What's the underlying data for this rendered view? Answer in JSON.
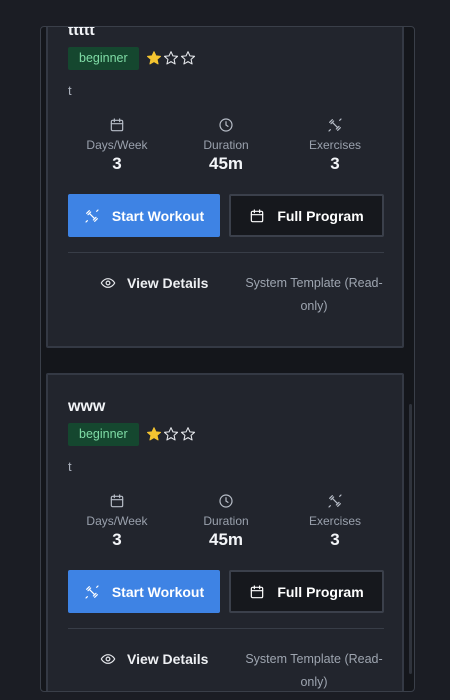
{
  "cards": [
    {
      "title": "ttttt",
      "badge": "beginner",
      "rating": {
        "filled": 1,
        "total": 3
      },
      "description": "t",
      "stats": [
        {
          "icon": "calendar-icon",
          "label": "Days/Week",
          "value": "3"
        },
        {
          "icon": "clock-icon",
          "label": "Duration",
          "value": "45m"
        },
        {
          "icon": "dumbbell-icon",
          "label": "Exercises",
          "value": "3"
        }
      ],
      "start_label": "Start Workout",
      "program_label": "Full Program",
      "details_label": "View Details",
      "note": "System Template (Read-only)"
    },
    {
      "title": "www",
      "badge": "beginner",
      "rating": {
        "filled": 1,
        "total": 3
      },
      "description": "t",
      "stats": [
        {
          "icon": "calendar-icon",
          "label": "Days/Week",
          "value": "3"
        },
        {
          "icon": "clock-icon",
          "label": "Duration",
          "value": "45m"
        },
        {
          "icon": "dumbbell-icon",
          "label": "Exercises",
          "value": "3"
        }
      ],
      "start_label": "Start Workout",
      "program_label": "Full Program",
      "details_label": "View Details",
      "note": "System Template (Read-only)"
    }
  ],
  "colors": {
    "background": "#1b1d24",
    "card": "#22252d",
    "primary": "#3e83e4",
    "badge_bg": "#15472f",
    "badge_text": "#7fdca6",
    "star": "#f4c430"
  }
}
